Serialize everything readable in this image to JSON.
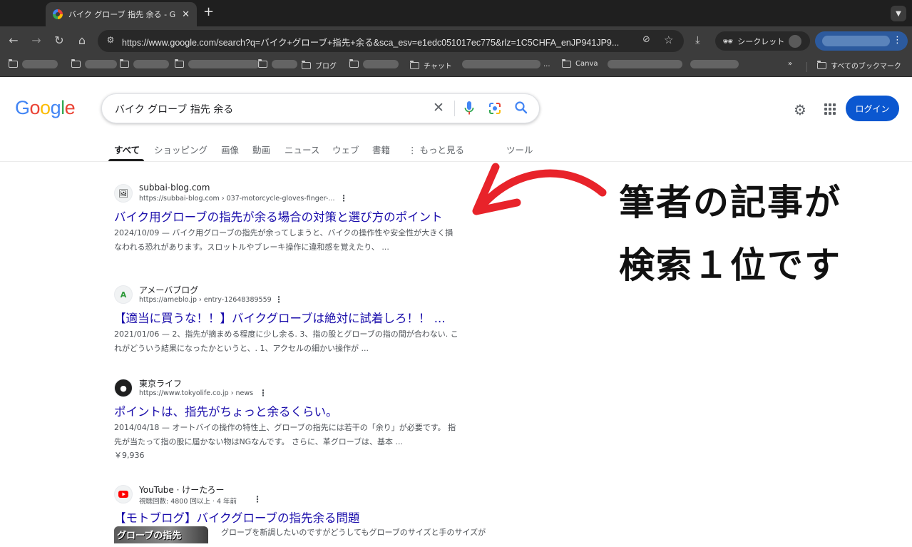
{
  "browser": {
    "tab_title": "バイク グローブ 指先 余る - Goo",
    "url": "https://www.google.com/search?q=バイク+グローブ+指先+余る&sca_esv=e1edc051017ec775&rlz=1C5CHFA_enJP941JP9...",
    "incognito_label": "シークレット",
    "bookmarks": [
      "ブログ",
      "チャット",
      "Canva"
    ],
    "all_bookmarks_label": "すべてのブックマーク"
  },
  "google": {
    "query": "バイク グローブ 指先 余る",
    "login_label": "ログイン",
    "tabs": [
      "すべて",
      "ショッピング",
      "画像",
      "動画",
      "ニュース",
      "ウェブ",
      "書籍",
      "もっと見る",
      "ツール"
    ],
    "logo_letters": [
      "G",
      "o",
      "o",
      "g",
      "l",
      "e"
    ]
  },
  "results": [
    {
      "site": "subbai-blog.com",
      "url": "https://subbai-blog.com › 037-motorcycle-gloves-finger-...",
      "title": "バイク用グローブの指先が余る場合の対策と選び方のポイント",
      "snippet1": "2024/10/09 — バイク用グローブの指先が余ってしまうと、バイクの操作性や安全性が大きく損",
      "snippet2": "なわれる恐れがあります。スロットルやブレーキ操作に違和感を覚えたり、 ..."
    },
    {
      "site": "アメーバブログ",
      "url": "https://ameblo.jp › entry-12648389559",
      "title": "【適当に買うな！！】バイクグローブは絶対に試着しろ！！ ...",
      "snippet1": "2021/01/06 — 2、指先が摘まめる程度に少し余る. 3、指の股とグローブの指の間が合わない. こ",
      "snippet2": "れがどういう結果になったかというと、. 1、アクセルの細かい操作が ..."
    },
    {
      "site": "東京ライフ",
      "url": "https://www.tokyolife.co.jp › news",
      "title": "ポイントは、指先がちょっと余るくらい。",
      "snippet1": "2014/04/18 — オートバイの操作の特性上、グローブの指先には若干の「余り」が必要です。 指",
      "snippet2": "先が当たって指の股に届かない物はNGなんです。 さらに、革グローブは、基本 ...",
      "price": "￥9,936"
    },
    {
      "site": "YouTube · けーたろー",
      "url": "視聴回数: 4800 回以上 · 4 年前",
      "title": "【モトブログ】バイクグローブの指先余る問題",
      "thumb_text": "グローブの指先",
      "snippet1": "グローブを新調したいのですがどうしてもグローブのサイズと手のサイズが"
    }
  ],
  "annotation": {
    "line1": "筆者の記事が",
    "line2": "検索１位です",
    "arrow_color": "#e8232a"
  },
  "colors": {
    "link": "#1a0dab",
    "login_button": "#0b57d0",
    "chrome_dark": "#3c3c3c"
  }
}
